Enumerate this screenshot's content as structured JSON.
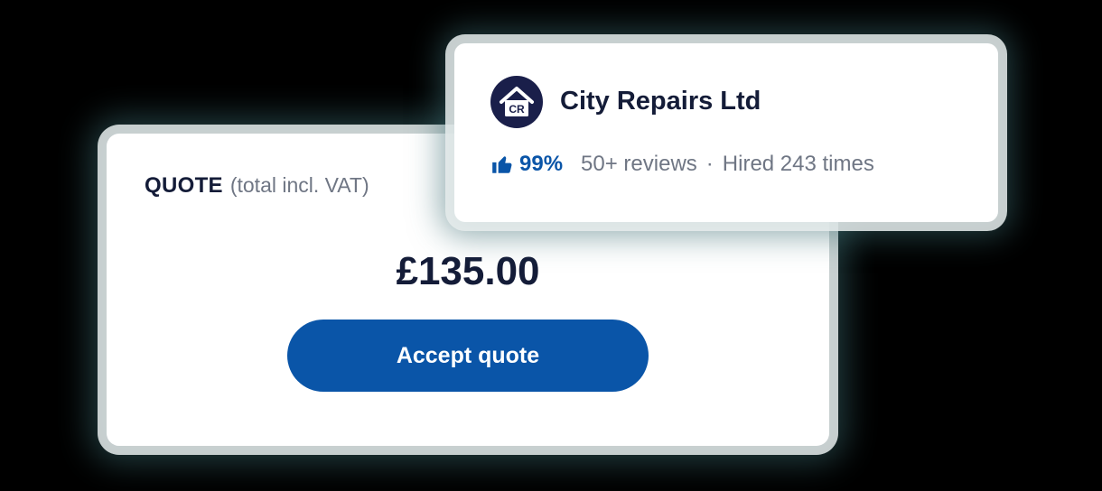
{
  "quote": {
    "label": "QUOTE",
    "sublabel": "(total incl. VAT)",
    "price": "£135.00",
    "accept_label": "Accept quote"
  },
  "company": {
    "logo_text": "CR",
    "name": "City Repairs Ltd",
    "rating": "99%",
    "reviews": "50+ reviews",
    "separator": "·",
    "hired": "Hired 243 times"
  },
  "icons": {
    "logo": "house-logo-icon",
    "rating": "thumbs-up-icon"
  },
  "colors": {
    "accent": "#0a55a8",
    "text_dark": "#141c38",
    "text_muted": "#6f7684",
    "logo_bg": "#1a1f4a"
  }
}
